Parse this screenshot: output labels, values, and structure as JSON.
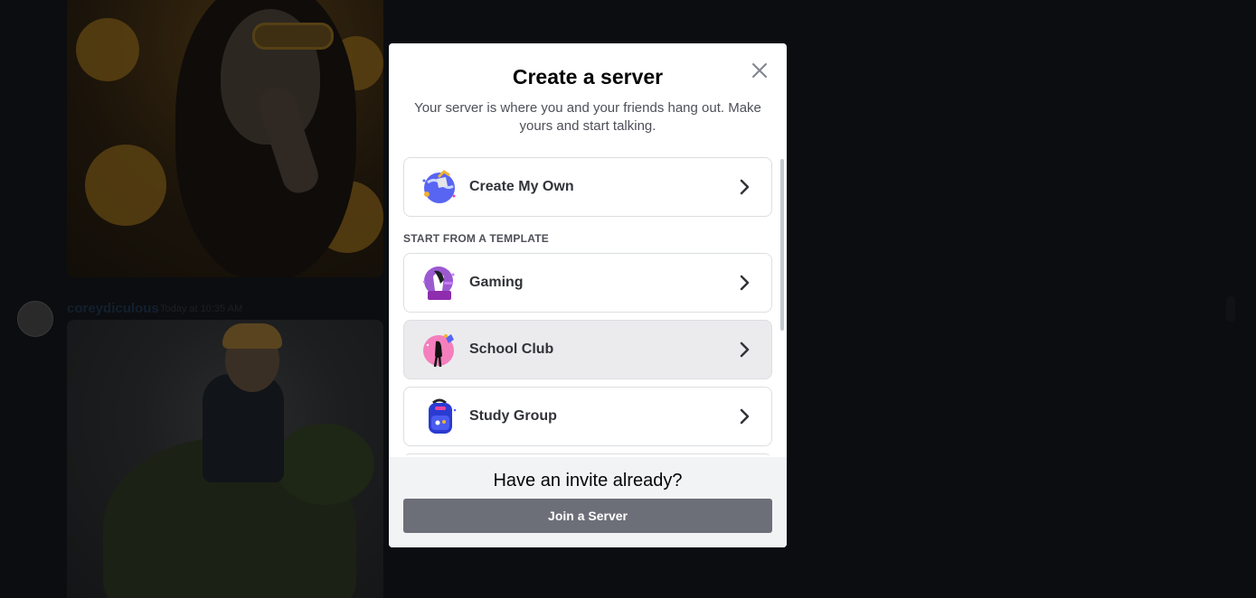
{
  "background": {
    "message": {
      "username": "coreydiculous",
      "timestamp": "Today at 10:35 AM"
    }
  },
  "modal": {
    "title": "Create a server",
    "subtitle": "Your server is where you and your friends hang out. Make yours and start talking.",
    "create_own": {
      "label": "Create My Own",
      "icon": "globe-flag-icon"
    },
    "section_label": "START FROM A TEMPLATE",
    "templates": [
      {
        "label": "Gaming",
        "icon": "gaming-icon"
      },
      {
        "label": "School Club",
        "icon": "school-club-icon"
      },
      {
        "label": "Study Group",
        "icon": "backpack-icon"
      }
    ],
    "footer": {
      "title": "Have an invite already?",
      "button": "Join a Server"
    }
  },
  "colors": {
    "overlay": "#0b0c0f",
    "modal_bg": "#ffffff",
    "footer_bg": "#f2f3f5",
    "join_button": "#6d6f78",
    "hovered_option": "#ebebed"
  }
}
